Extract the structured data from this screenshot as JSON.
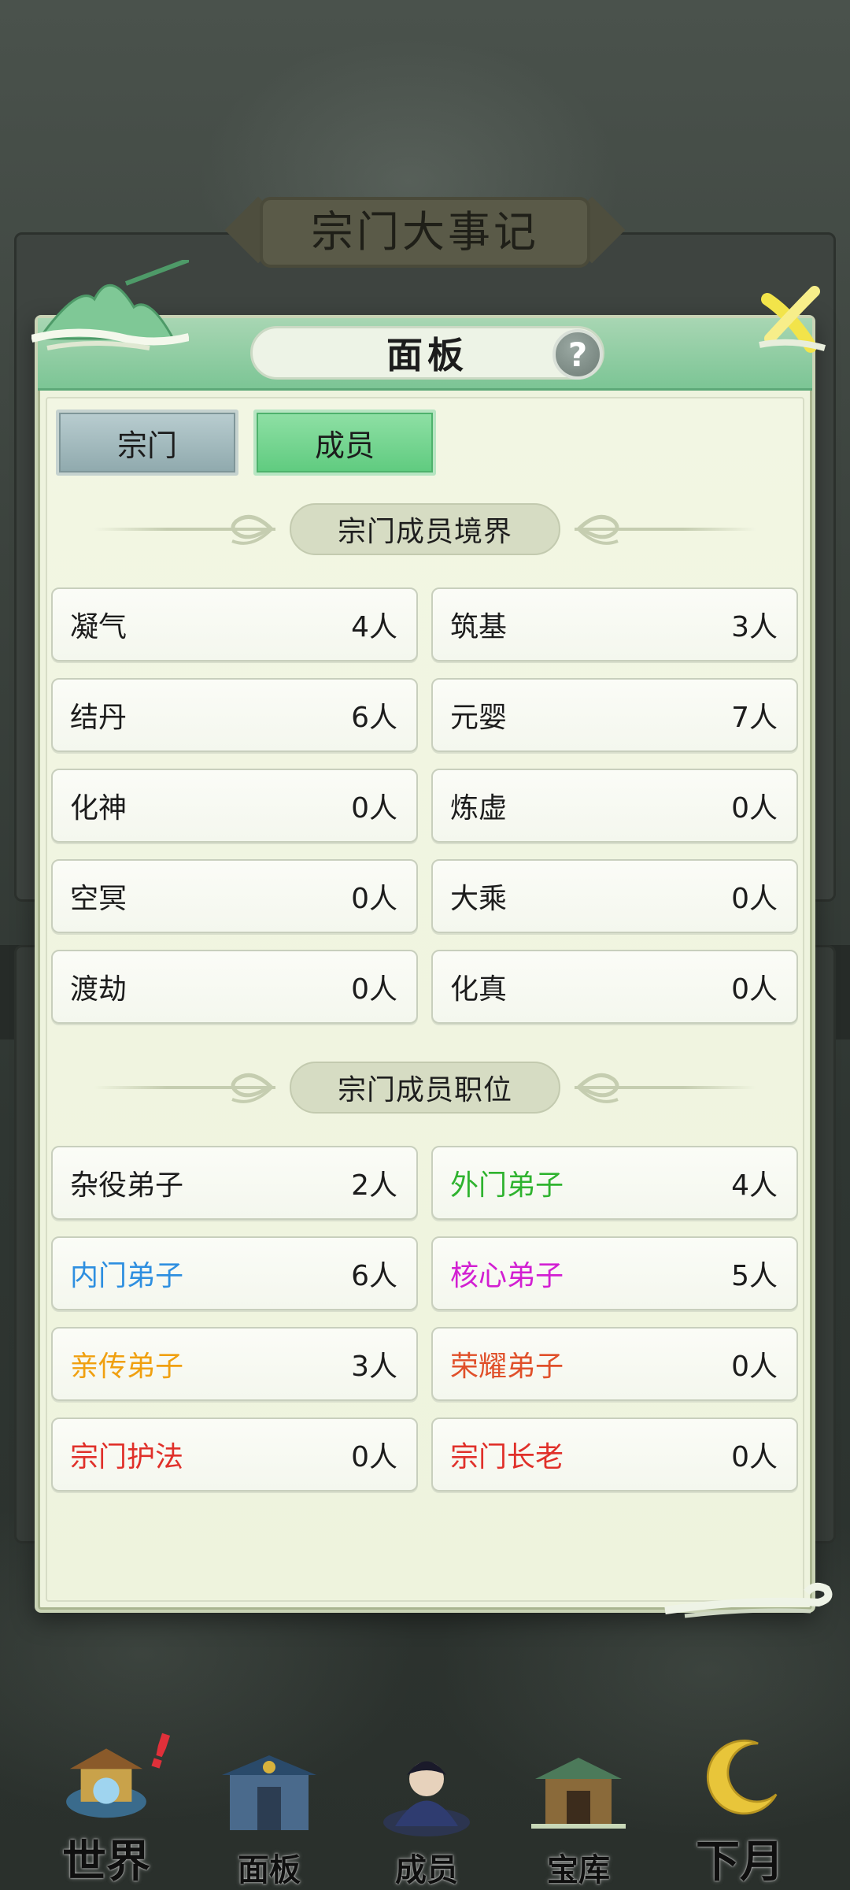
{
  "background": {
    "title": "宗门大事记"
  },
  "modal": {
    "title": "面板",
    "help_glyph": "?",
    "tabs": [
      {
        "label": "宗门",
        "active": false
      },
      {
        "label": "成员",
        "active": true
      }
    ],
    "realm_section": {
      "title": "宗门成员境界",
      "items": [
        {
          "name": "凝气",
          "count": "4人"
        },
        {
          "name": "筑基",
          "count": "3人"
        },
        {
          "name": "结丹",
          "count": "6人"
        },
        {
          "name": "元婴",
          "count": "7人"
        },
        {
          "name": "化神",
          "count": "0人"
        },
        {
          "name": "炼虚",
          "count": "0人"
        },
        {
          "name": "空冥",
          "count": "0人"
        },
        {
          "name": "大乘",
          "count": "0人"
        },
        {
          "name": "渡劫",
          "count": "0人"
        },
        {
          "name": "化真",
          "count": "0人"
        }
      ]
    },
    "position_section": {
      "title": "宗门成员职位",
      "items": [
        {
          "name": "杂役弟子",
          "count": "2人",
          "color": "#1c1c1c"
        },
        {
          "name": "外门弟子",
          "count": "4人",
          "color": "#2fb32f"
        },
        {
          "name": "内门弟子",
          "count": "6人",
          "color": "#2e8fe0"
        },
        {
          "name": "核心弟子",
          "count": "5人",
          "color": "#d21fd2"
        },
        {
          "name": "亲传弟子",
          "count": "3人",
          "color": "#f0a010"
        },
        {
          "name": "荣耀弟子",
          "count": "0人",
          "color": "#e0502a"
        },
        {
          "name": "宗门护法",
          "count": "0人",
          "color": "#e0302a"
        },
        {
          "name": "宗门长老",
          "count": "0人",
          "color": "#e0302a"
        }
      ]
    }
  },
  "bottom_nav": {
    "items": [
      {
        "label": "世界",
        "icon": "pagoda-icon"
      },
      {
        "label": "面板",
        "icon": "gate-icon"
      },
      {
        "label": "成员",
        "icon": "cultivator-icon"
      },
      {
        "label": "宝库",
        "icon": "treasury-icon"
      },
      {
        "label": "下月",
        "icon": "moon-icon"
      }
    ],
    "alert_glyph": "!"
  }
}
